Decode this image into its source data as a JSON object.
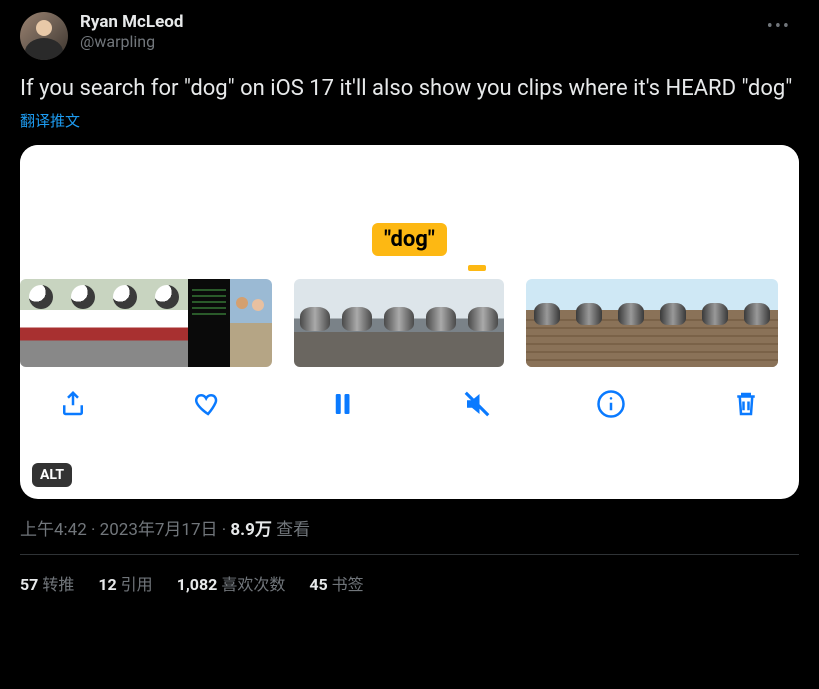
{
  "author": {
    "display_name": "Ryan McLeod",
    "handle": "@warpling"
  },
  "tweet_text": "If you search for \"dog\" on iOS 17 it'll also show you clips where it's HEARD \"dog\"",
  "translate_label": "翻译推文",
  "media": {
    "search_tag": "\"dog\"",
    "alt_badge": "ALT"
  },
  "meta": {
    "time": "上午4:42",
    "date": "2023年7月17日",
    "views_count": "8.9万",
    "views_label": "查看"
  },
  "stats": {
    "retweets": {
      "count": "57",
      "label": "转推"
    },
    "quotes": {
      "count": "12",
      "label": "引用"
    },
    "likes": {
      "count": "1,082",
      "label": "喜欢次数"
    },
    "bookmarks": {
      "count": "45",
      "label": "书签"
    }
  }
}
